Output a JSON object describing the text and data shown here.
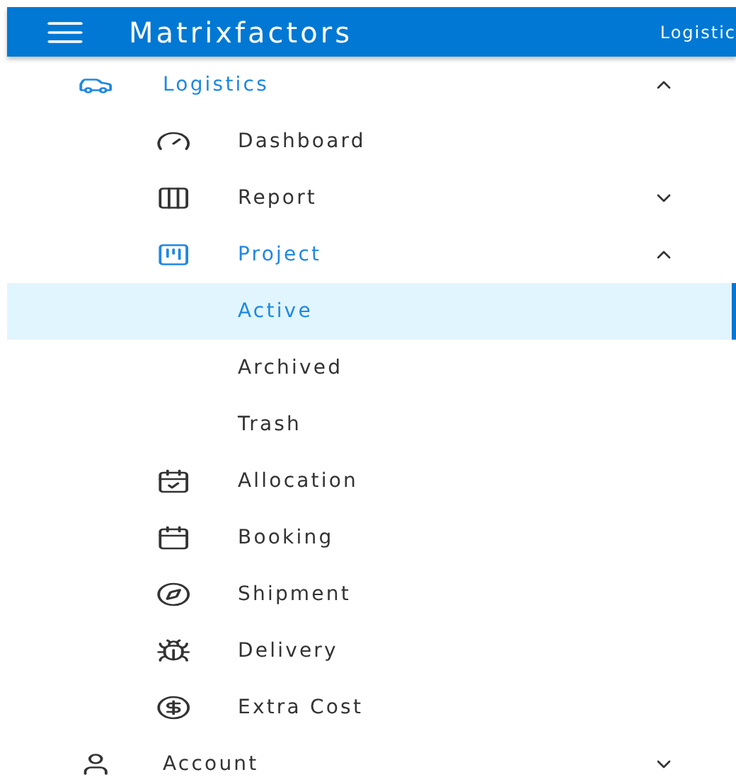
{
  "header": {
    "title": "Matrixfactors",
    "breadcrumb": "Logistic"
  },
  "nav": [
    {
      "label": "Logistics",
      "highlighted": true,
      "selected": false,
      "expanded": true,
      "children": [
        {
          "label": "Dashboard",
          "highlighted": false,
          "selected": false
        },
        {
          "label": "Report",
          "highlighted": false,
          "selected": false,
          "expanded": false
        },
        {
          "label": "Project",
          "highlighted": true,
          "selected": false,
          "expanded": true,
          "children": [
            {
              "label": "Active",
              "highlighted": true,
              "selected": true
            },
            {
              "label": "Archived",
              "highlighted": false,
              "selected": false
            },
            {
              "label": "Trash",
              "highlighted": false,
              "selected": false
            }
          ]
        },
        {
          "label": "Allocation",
          "highlighted": false,
          "selected": false
        },
        {
          "label": "Booking",
          "highlighted": false,
          "selected": false
        },
        {
          "label": "Shipment",
          "highlighted": false,
          "selected": false
        },
        {
          "label": "Delivery",
          "highlighted": false,
          "selected": false
        },
        {
          "label": "Extra Cost",
          "highlighted": false,
          "selected": false
        }
      ]
    },
    {
      "label": "Account",
      "highlighted": false,
      "selected": false,
      "expanded": false
    }
  ]
}
